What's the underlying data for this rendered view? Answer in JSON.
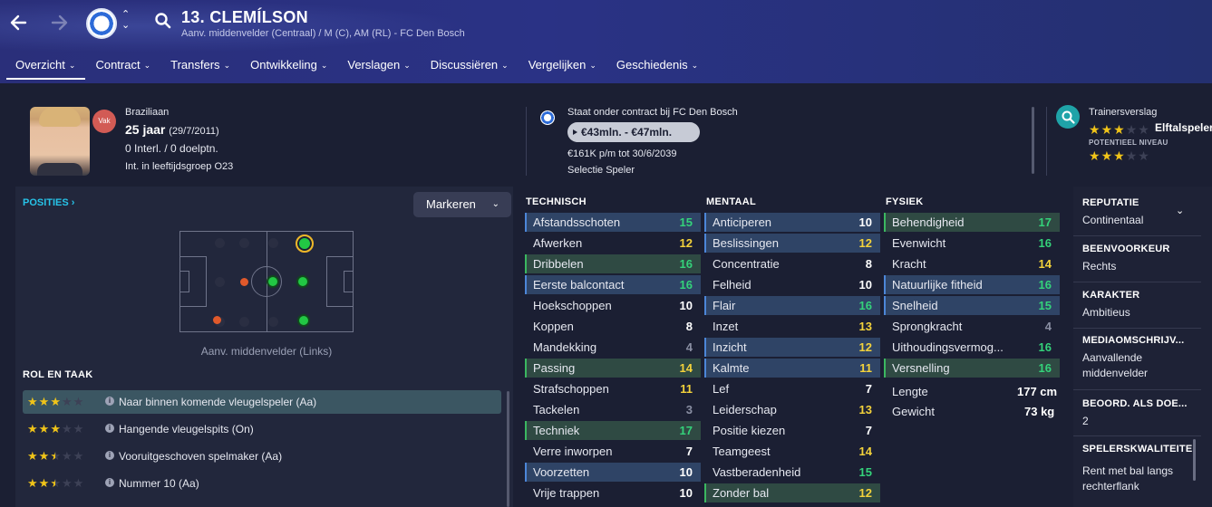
{
  "header": {
    "player_name": "13. CLEMÍLSON",
    "subtitle": "Aanv. middenvelder (Centraal) / M (C), AM (RL) - FC Den Bosch",
    "tabs": [
      {
        "label": "Overzicht"
      },
      {
        "label": "Contract"
      },
      {
        "label": "Transfers"
      },
      {
        "label": "Ontwikkeling"
      },
      {
        "label": "Verslagen"
      },
      {
        "label": "Discussiëren"
      },
      {
        "label": "Vergelijken"
      },
      {
        "label": "Geschiedenis"
      }
    ]
  },
  "profile": {
    "status_badge": "Vak",
    "nationality": "Braziliaan",
    "age": "25 jaar",
    "dob": "(29/7/2011)",
    "international": "0 Interl. / 0 doelptn.",
    "intl_group": "Int. in leeftijdsgroep O23"
  },
  "contract": {
    "club_line": "Staat onder contract bij FC Den Bosch",
    "value": "€43mln. - €47mln.",
    "wage": "€161K p/m tot 30/6/2039",
    "status": "Selectie Speler"
  },
  "scouting": {
    "label": "Trainersverslag",
    "current_stars": 3,
    "current_text": "Elftalspeler",
    "potential_label": "POTENTIEEL NIVEAU",
    "potential_stars": 3,
    "max_stars": 5
  },
  "positions": {
    "title": "POSITIES ›",
    "highlight_button": "Markeren",
    "caption": "Aanv. middenvelder (Links)"
  },
  "roles": {
    "title": "ROL EN TAAK",
    "items": [
      {
        "stars": 3,
        "label": "Naar binnen komende vleugelspeler (Aa)"
      },
      {
        "stars": 3,
        "label": "Hangende vleugelspits (On)"
      },
      {
        "stars": 2.5,
        "label": "Vooruitgeschoven spelmaker (Aa)"
      },
      {
        "stars": 2.5,
        "label": "Nummer 10 (Aa)"
      }
    ]
  },
  "attributes": {
    "technical_title": "TECHNISCH",
    "mental_title": "MENTAAL",
    "physical_title": "FYSIEK",
    "technical": [
      {
        "name": "Afstandsschoten",
        "value": "15"
      },
      {
        "name": "Afwerken",
        "value": "12"
      },
      {
        "name": "Dribbelen",
        "value": "16"
      },
      {
        "name": "Eerste balcontact",
        "value": "16"
      },
      {
        "name": "Hoekschoppen",
        "value": "10"
      },
      {
        "name": "Koppen",
        "value": "8"
      },
      {
        "name": "Mandekking",
        "value": "4"
      },
      {
        "name": "Passing",
        "value": "14"
      },
      {
        "name": "Strafschoppen",
        "value": "11"
      },
      {
        "name": "Tackelen",
        "value": "3"
      },
      {
        "name": "Techniek",
        "value": "17"
      },
      {
        "name": "Verre inworpen",
        "value": "7"
      },
      {
        "name": "Voorzetten",
        "value": "10"
      },
      {
        "name": "Vrije trappen",
        "value": "10"
      }
    ],
    "mental": [
      {
        "name": "Anticiperen",
        "value": "10"
      },
      {
        "name": "Beslissingen",
        "value": "12"
      },
      {
        "name": "Concentratie",
        "value": "8"
      },
      {
        "name": "Felheid",
        "value": "10"
      },
      {
        "name": "Flair",
        "value": "16"
      },
      {
        "name": "Inzet",
        "value": "13"
      },
      {
        "name": "Inzicht",
        "value": "12"
      },
      {
        "name": "Kalmte",
        "value": "11"
      },
      {
        "name": "Lef",
        "value": "7"
      },
      {
        "name": "Leiderschap",
        "value": "13"
      },
      {
        "name": "Positie kiezen",
        "value": "7"
      },
      {
        "name": "Teamgeest",
        "value": "14"
      },
      {
        "name": "Vastberadenheid",
        "value": "15"
      },
      {
        "name": "Zonder bal",
        "value": "12"
      }
    ],
    "physical": [
      {
        "name": "Behendigheid",
        "value": "17"
      },
      {
        "name": "Evenwicht",
        "value": "16"
      },
      {
        "name": "Kracht",
        "value": "14"
      },
      {
        "name": "Natuurlijke fitheid",
        "value": "16"
      },
      {
        "name": "Snelheid",
        "value": "15"
      },
      {
        "name": "Sprongkracht",
        "value": "4"
      },
      {
        "name": "Uithoudingsvermog...",
        "value": "16"
      },
      {
        "name": "Versnelling",
        "value": "16"
      }
    ],
    "height_label": "Lengte",
    "height_value": "177 cm",
    "weight_label": "Gewicht",
    "weight_value": "73 kg"
  },
  "info": {
    "reputation_label": "REPUTATIE",
    "reputation_value": "Continentaal",
    "foot_label": "BEENVOORKEUR",
    "foot_value": "Rechts",
    "character_label": "KARAKTER",
    "character_value": "Ambitieus",
    "media_label": "MEDIAOMSCHRIJV...",
    "media_value": "Aanvallende middenvelder",
    "rating_label": "BEOORD. ALS DOE...",
    "rating_value": "2",
    "quality_label": "SPELERSKWALITEITE",
    "quality_value": "Rent met bal langs rechterflank"
  },
  "colors": {
    "header_bg": "#2a3285",
    "accent_cyan": "#27c3e8",
    "star_gold": "#f0c419",
    "value_green": "#34d27a",
    "value_yellow": "#f3d23b"
  }
}
